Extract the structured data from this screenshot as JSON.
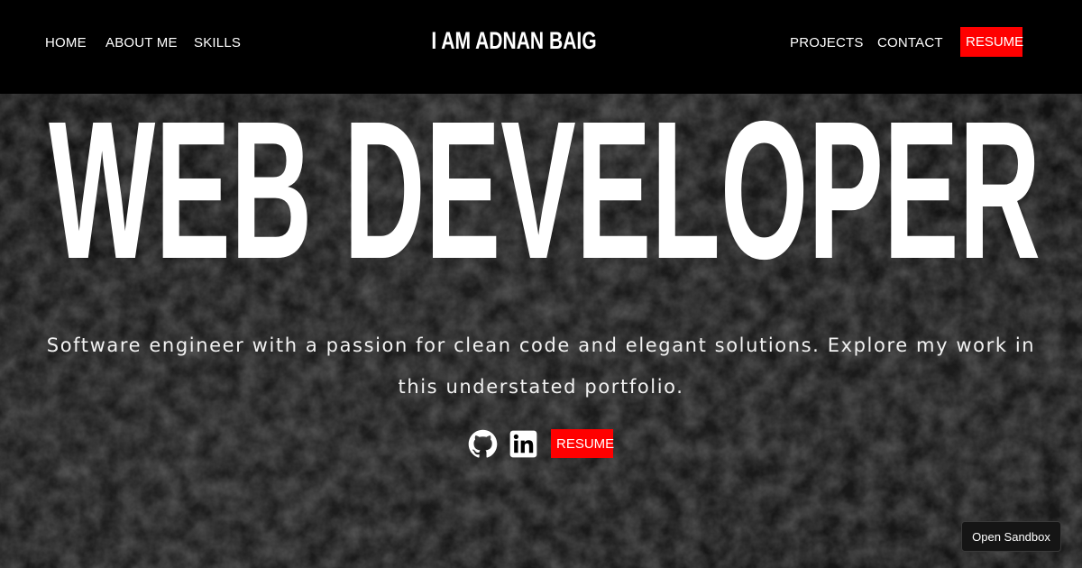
{
  "nav": {
    "left_links": [
      "HOME",
      "ABOUT ME",
      "SKILLS"
    ],
    "brand": "I AM ADNAN BAIG",
    "right_links": [
      "PROJECTS",
      "CONTACT"
    ],
    "resume_label": "RESUME"
  },
  "hero": {
    "headline": "WEB DEVELOPER",
    "tagline_line1": "Software engineer with a passion for clean code and elegant solutions. Explore my work in",
    "tagline_line2": "this understated portfolio.",
    "social": {
      "github_icon": "github-icon",
      "linkedin_icon": "linkedin-icon"
    },
    "resume_label": "RESUME"
  },
  "sandbox": {
    "label": "Open Sandbox"
  },
  "colors": {
    "accent": "#ff0000",
    "nav_bg": "#000000",
    "text": "#ffffff"
  }
}
